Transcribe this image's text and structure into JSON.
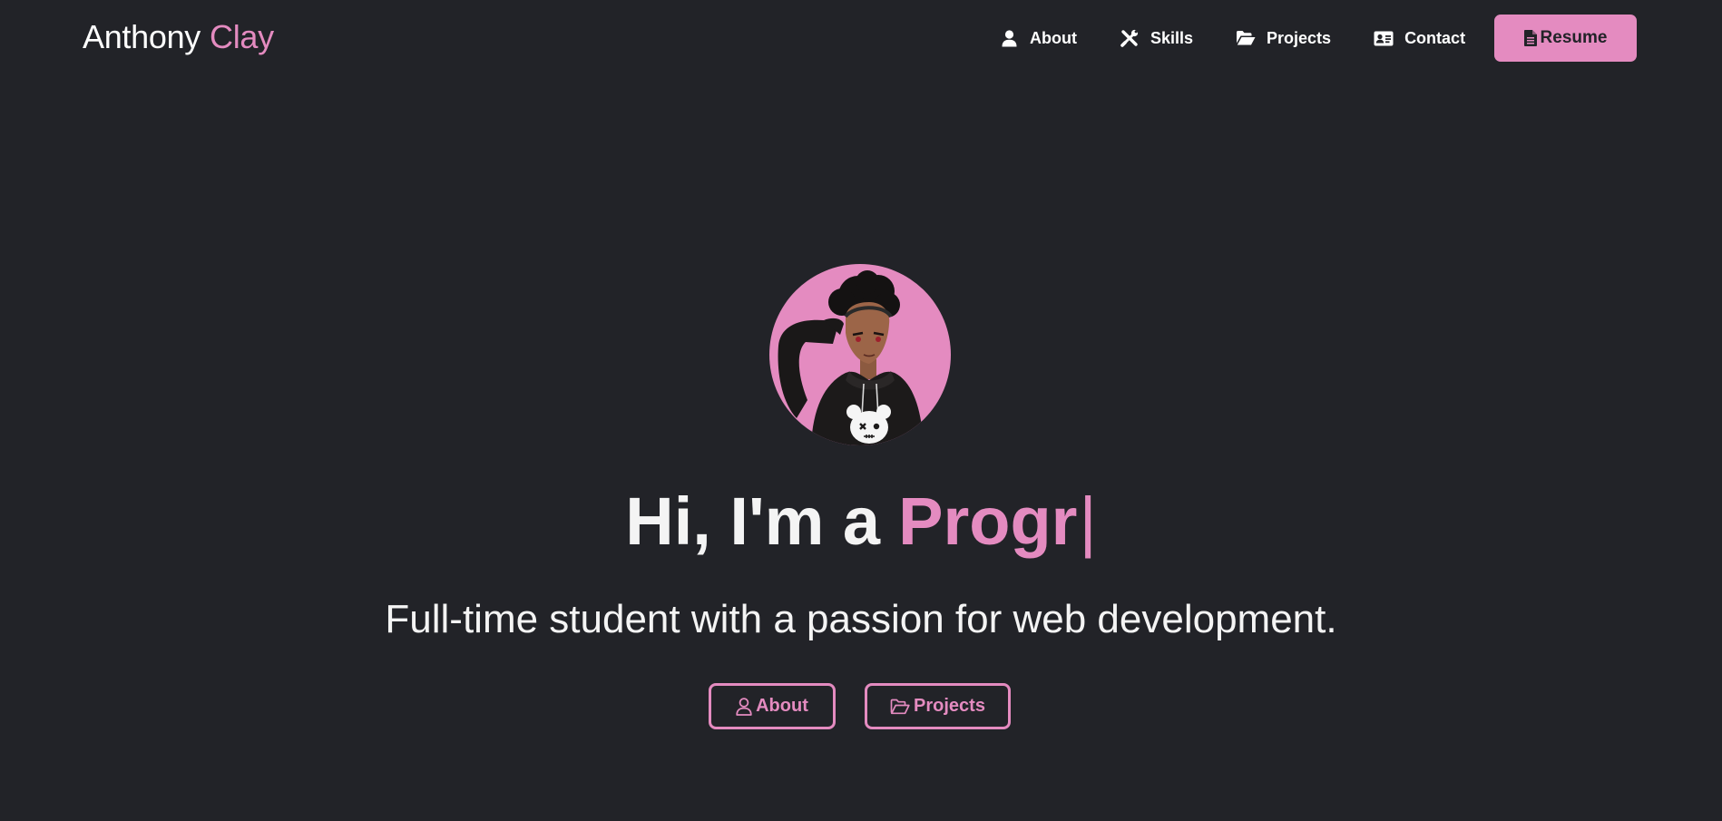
{
  "brand": {
    "first_name": "Anthony",
    "last_name": "Clay"
  },
  "nav": {
    "items": [
      {
        "label": "About",
        "icon": "user-icon"
      },
      {
        "label": "Skills",
        "icon": "tools-icon"
      },
      {
        "label": "Projects",
        "icon": "folder-open-icon"
      },
      {
        "label": "Contact",
        "icon": "address-card-icon"
      }
    ],
    "resume_label": "Resume",
    "resume_icon": "file-icon"
  },
  "hero": {
    "avatar_alt": "avatar",
    "greeting": "Hi, I'm a",
    "typed_text": "Progr",
    "cursor": "|",
    "subtitle": "Full-time student with a passion for web development.",
    "buttons": [
      {
        "label": "About",
        "icon": "user-outline-icon"
      },
      {
        "label": "Projects",
        "icon": "folder-open-outline-icon"
      }
    ]
  },
  "colors": {
    "background": "#222328",
    "accent": "#e48bc0",
    "text": "#ffffff"
  }
}
